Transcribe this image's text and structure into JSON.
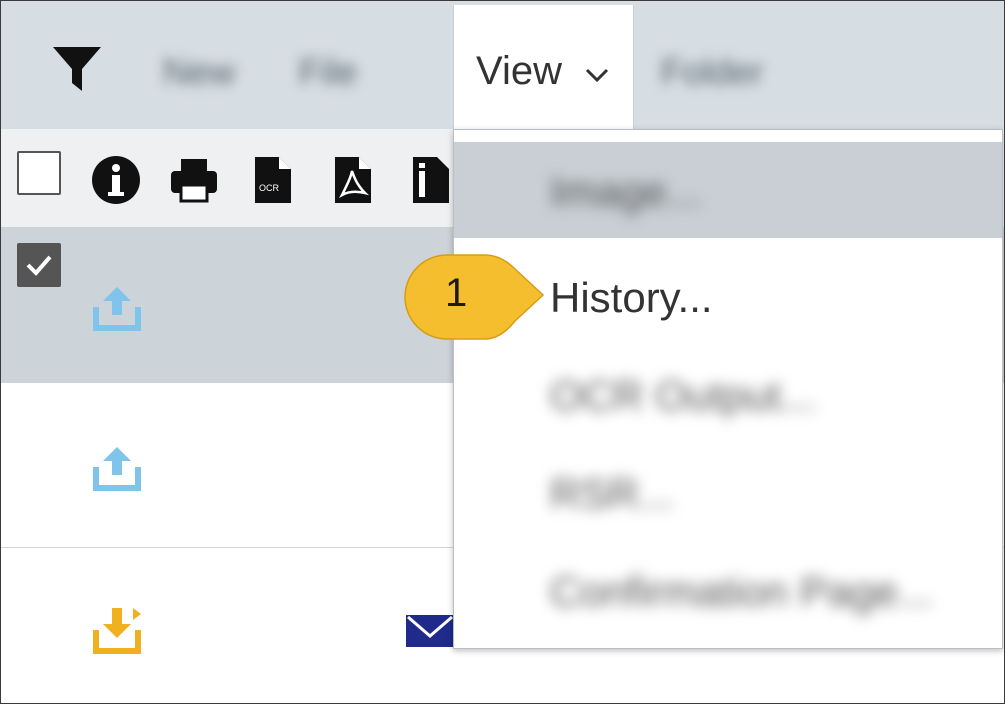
{
  "toolbar": {
    "blurred_tabs": [
      "New",
      "File",
      "Folder"
    ],
    "view_label": "View"
  },
  "menu": {
    "items": [
      {
        "label": "Image...",
        "state": "hover-blurred"
      },
      {
        "label": "History...",
        "state": "normal"
      },
      {
        "label": "OCR Output...",
        "state": "blurred"
      },
      {
        "label": "RSR...",
        "state": "blurred"
      },
      {
        "label": "Confirmation Page...",
        "state": "blurred"
      }
    ]
  },
  "callout": {
    "number": "1"
  },
  "colors": {
    "toolbar_bg": "#d6dde3",
    "selected_row": "#ccd3d9",
    "upload_icon": "#7fc4ea",
    "download_icon": "#f0b020",
    "callout": "#f5be2e",
    "mail_icon": "#1f2a8a"
  },
  "icons": [
    "filter-icon",
    "info-icon",
    "print-icon",
    "ocr-file-icon",
    "pdf-file-icon",
    "document-icon",
    "upload-icon",
    "download-icon",
    "mail-icon"
  ]
}
